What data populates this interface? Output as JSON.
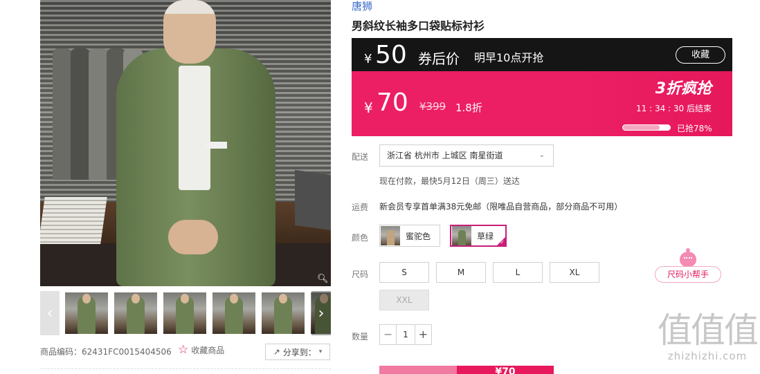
{
  "product": {
    "brand": "唐狮",
    "title": "男斜纹长袖多口袋贴标衬衫",
    "sku_label": "商品编码：62431FC0015404506",
    "favorite_label": "收藏商品",
    "share_label": "分享到："
  },
  "price": {
    "currency": "¥",
    "coupon_price": "50",
    "coupon_label": "券后价",
    "coupon_start": "明早10点开抢",
    "collect_label": "收藏",
    "sale_price": "70",
    "original_price": "¥399",
    "discount": "1.8折",
    "flash_title": "3折疯抢",
    "countdown": "11 : 34 : 30  后结束",
    "sold_progress": 0.78,
    "sold_text": "已抢78%"
  },
  "delivery": {
    "label": "配送",
    "region": "浙江省 杭州市 上城区 南星街道",
    "note": "现在付款，最快5月12日（周三）送达"
  },
  "freight": {
    "label": "运费",
    "text": "新会员专享首单满38元免邮（限唯品自营商品，部分商品不可用）"
  },
  "colors": {
    "label": "颜色",
    "options": [
      {
        "name": "蜜驼色",
        "selected": false
      },
      {
        "name": "草绿",
        "selected": true
      }
    ]
  },
  "sizes": {
    "label": "尺码",
    "options": [
      {
        "name": "S",
        "available": true
      },
      {
        "name": "M",
        "available": true
      },
      {
        "name": "L",
        "available": true
      },
      {
        "name": "XL",
        "available": true
      },
      {
        "name": "XXL",
        "available": false
      }
    ],
    "helper_label": "尺码小帮手"
  },
  "quantity": {
    "label": "数量",
    "value": "1",
    "minus": "−",
    "plus": "+"
  },
  "buy": {
    "price_label": "¥70"
  },
  "watermark": {
    "logo": "值值值",
    "site": "zhizhizhi.com"
  },
  "icons": {
    "thumb_prev": "chevron-left-icon",
    "thumb_next": "chevron-right-icon",
    "zoom": "magnifier-icon",
    "favorite": "star-icon",
    "share": "share-icon",
    "select": "chevron-down-icon"
  },
  "colors_theme": {
    "accent": "#e3195c",
    "coupon_bar": "#151515",
    "sale_bar": "#ec1f64",
    "brand_link": "#3a6bc9"
  }
}
